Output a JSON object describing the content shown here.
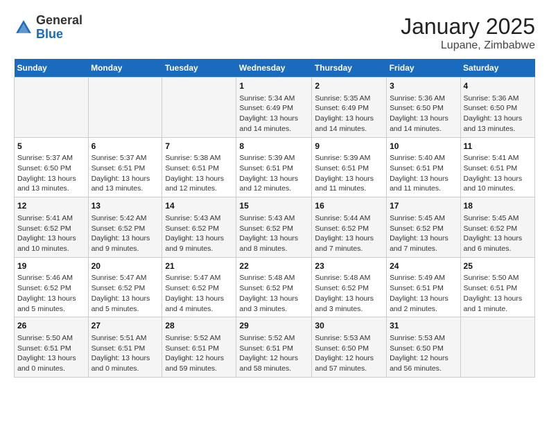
{
  "logo": {
    "general": "General",
    "blue": "Blue"
  },
  "title": "January 2025",
  "subtitle": "Lupane, Zimbabwe",
  "days_header": [
    "Sunday",
    "Monday",
    "Tuesday",
    "Wednesday",
    "Thursday",
    "Friday",
    "Saturday"
  ],
  "weeks": [
    [
      {
        "num": "",
        "info": ""
      },
      {
        "num": "",
        "info": ""
      },
      {
        "num": "",
        "info": ""
      },
      {
        "num": "1",
        "info": "Sunrise: 5:34 AM\nSunset: 6:49 PM\nDaylight: 13 hours and 14 minutes."
      },
      {
        "num": "2",
        "info": "Sunrise: 5:35 AM\nSunset: 6:49 PM\nDaylight: 13 hours and 14 minutes."
      },
      {
        "num": "3",
        "info": "Sunrise: 5:36 AM\nSunset: 6:50 PM\nDaylight: 13 hours and 14 minutes."
      },
      {
        "num": "4",
        "info": "Sunrise: 5:36 AM\nSunset: 6:50 PM\nDaylight: 13 hours and 13 minutes."
      }
    ],
    [
      {
        "num": "5",
        "info": "Sunrise: 5:37 AM\nSunset: 6:50 PM\nDaylight: 13 hours and 13 minutes."
      },
      {
        "num": "6",
        "info": "Sunrise: 5:37 AM\nSunset: 6:51 PM\nDaylight: 13 hours and 13 minutes."
      },
      {
        "num": "7",
        "info": "Sunrise: 5:38 AM\nSunset: 6:51 PM\nDaylight: 13 hours and 12 minutes."
      },
      {
        "num": "8",
        "info": "Sunrise: 5:39 AM\nSunset: 6:51 PM\nDaylight: 13 hours and 12 minutes."
      },
      {
        "num": "9",
        "info": "Sunrise: 5:39 AM\nSunset: 6:51 PM\nDaylight: 13 hours and 11 minutes."
      },
      {
        "num": "10",
        "info": "Sunrise: 5:40 AM\nSunset: 6:51 PM\nDaylight: 13 hours and 11 minutes."
      },
      {
        "num": "11",
        "info": "Sunrise: 5:41 AM\nSunset: 6:51 PM\nDaylight: 13 hours and 10 minutes."
      }
    ],
    [
      {
        "num": "12",
        "info": "Sunrise: 5:41 AM\nSunset: 6:52 PM\nDaylight: 13 hours and 10 minutes."
      },
      {
        "num": "13",
        "info": "Sunrise: 5:42 AM\nSunset: 6:52 PM\nDaylight: 13 hours and 9 minutes."
      },
      {
        "num": "14",
        "info": "Sunrise: 5:43 AM\nSunset: 6:52 PM\nDaylight: 13 hours and 9 minutes."
      },
      {
        "num": "15",
        "info": "Sunrise: 5:43 AM\nSunset: 6:52 PM\nDaylight: 13 hours and 8 minutes."
      },
      {
        "num": "16",
        "info": "Sunrise: 5:44 AM\nSunset: 6:52 PM\nDaylight: 13 hours and 7 minutes."
      },
      {
        "num": "17",
        "info": "Sunrise: 5:45 AM\nSunset: 6:52 PM\nDaylight: 13 hours and 7 minutes."
      },
      {
        "num": "18",
        "info": "Sunrise: 5:45 AM\nSunset: 6:52 PM\nDaylight: 13 hours and 6 minutes."
      }
    ],
    [
      {
        "num": "19",
        "info": "Sunrise: 5:46 AM\nSunset: 6:52 PM\nDaylight: 13 hours and 5 minutes."
      },
      {
        "num": "20",
        "info": "Sunrise: 5:47 AM\nSunset: 6:52 PM\nDaylight: 13 hours and 5 minutes."
      },
      {
        "num": "21",
        "info": "Sunrise: 5:47 AM\nSunset: 6:52 PM\nDaylight: 13 hours and 4 minutes."
      },
      {
        "num": "22",
        "info": "Sunrise: 5:48 AM\nSunset: 6:52 PM\nDaylight: 13 hours and 3 minutes."
      },
      {
        "num": "23",
        "info": "Sunrise: 5:48 AM\nSunset: 6:52 PM\nDaylight: 13 hours and 3 minutes."
      },
      {
        "num": "24",
        "info": "Sunrise: 5:49 AM\nSunset: 6:51 PM\nDaylight: 13 hours and 2 minutes."
      },
      {
        "num": "25",
        "info": "Sunrise: 5:50 AM\nSunset: 6:51 PM\nDaylight: 13 hours and 1 minute."
      }
    ],
    [
      {
        "num": "26",
        "info": "Sunrise: 5:50 AM\nSunset: 6:51 PM\nDaylight: 13 hours and 0 minutes."
      },
      {
        "num": "27",
        "info": "Sunrise: 5:51 AM\nSunset: 6:51 PM\nDaylight: 13 hours and 0 minutes."
      },
      {
        "num": "28",
        "info": "Sunrise: 5:52 AM\nSunset: 6:51 PM\nDaylight: 12 hours and 59 minutes."
      },
      {
        "num": "29",
        "info": "Sunrise: 5:52 AM\nSunset: 6:51 PM\nDaylight: 12 hours and 58 minutes."
      },
      {
        "num": "30",
        "info": "Sunrise: 5:53 AM\nSunset: 6:50 PM\nDaylight: 12 hours and 57 minutes."
      },
      {
        "num": "31",
        "info": "Sunrise: 5:53 AM\nSunset: 6:50 PM\nDaylight: 12 hours and 56 minutes."
      },
      {
        "num": "",
        "info": ""
      }
    ]
  ]
}
